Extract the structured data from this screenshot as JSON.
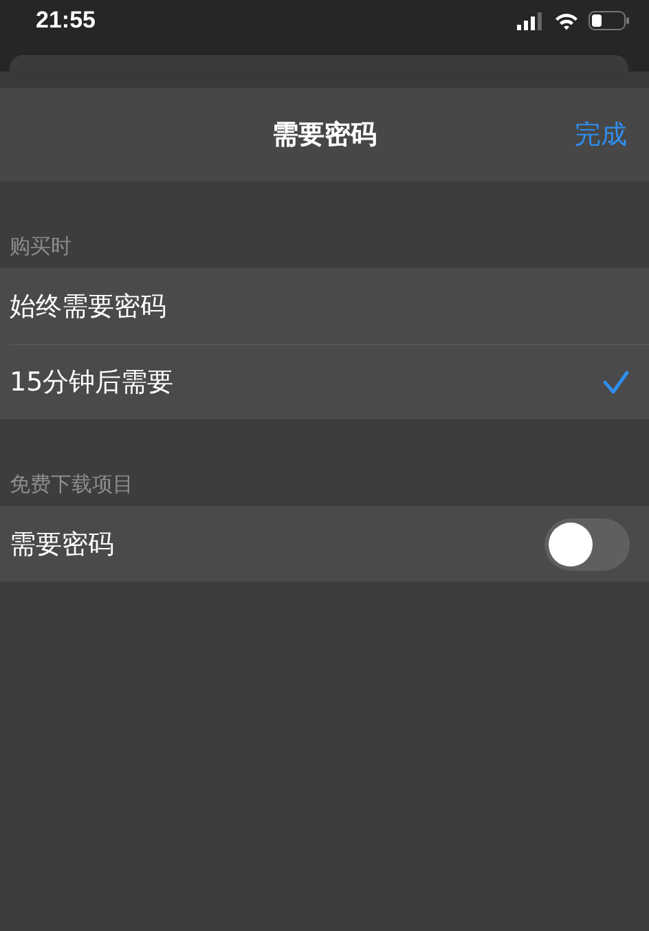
{
  "status_bar": {
    "time": "21:55"
  },
  "nav": {
    "title": "需要密码",
    "done": "完成"
  },
  "sections": [
    {
      "header": "购买时",
      "rows": [
        {
          "kind": "choice",
          "label": "始终需要密码",
          "selected": false
        },
        {
          "kind": "choice",
          "label": "15分钟后需要",
          "selected": true
        }
      ]
    },
    {
      "header": "免费下载项目",
      "rows": [
        {
          "kind": "switch",
          "label": "需要密码",
          "on": false
        }
      ]
    }
  ]
}
